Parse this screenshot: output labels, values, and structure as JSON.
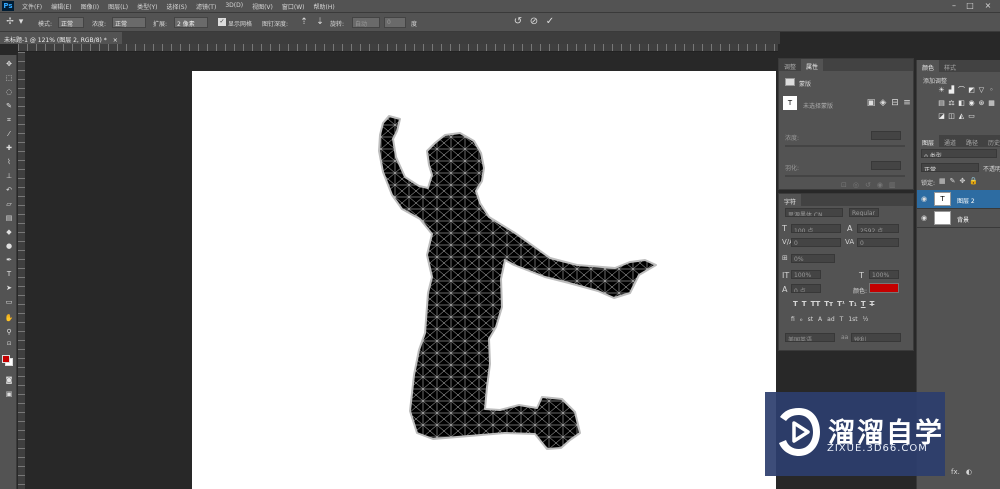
{
  "menubar": {
    "app_logo": "Ps",
    "items": [
      "文件(F)",
      "编辑(E)",
      "图像(I)",
      "图层(L)",
      "类型(Y)",
      "选择(S)",
      "滤镜(T)",
      "3D(D)",
      "视图(V)",
      "窗口(W)",
      "帮助(H)"
    ]
  },
  "options": {
    "mode_label": "模式:",
    "mode_value": "正常",
    "density_label": "浓度:",
    "density_value": "正常",
    "expand_label": "扩展:",
    "expand_value": "2 像素",
    "show_mesh_label": "显示网格",
    "pin_depth_label": "图钉深度:",
    "rotate_label": "旋转:",
    "rotate_value": "自动",
    "angle_value": "0",
    "angle_unit": "度"
  },
  "document_tab": {
    "title": "未标题-1 @ 121% (图层 2, RGB/8) *",
    "close": "×"
  },
  "properties_panel": {
    "tabs": [
      "调整",
      "属性"
    ],
    "mask_label": "蒙版",
    "no_mask_label": "未选择蒙版",
    "density_label": "浓度:",
    "feather_label": "羽化:"
  },
  "character_panel": {
    "title": "字符",
    "font_family": "思源黑体 CN",
    "font_style": "Regular",
    "font_size": "100 点",
    "leading": "2592 点",
    "kerning": "0",
    "tracking": "0",
    "scale_extra": "0%",
    "vertical_scale": "100%",
    "horizontal_scale": "100%",
    "baseline_shift": "0 点",
    "color_label": "颜色:",
    "color": "#c40000",
    "style_buttons": [
      "T",
      "T",
      "TT",
      "Tт",
      "T¹",
      "T₁",
      "T",
      "T"
    ],
    "opentype_buttons": [
      "fi",
      "ℴ",
      "st",
      "A",
      "ad",
      "T",
      "1st",
      "½"
    ],
    "language": "美国英语",
    "antialias": "锐利"
  },
  "right_panel": {
    "top_tabs": [
      "颜色",
      "样式"
    ],
    "add_adjustment_label": "添加调整",
    "layer_tabs": [
      "图层",
      "通道",
      "路径",
      "历史记"
    ],
    "kind_filter": "ρ 类型",
    "blend_mode": "正常",
    "opacity_label": "不透明",
    "lock_label": "锁定:",
    "layers": [
      {
        "name": "图层 2",
        "selected": true
      },
      {
        "name": "背景",
        "selected": false
      }
    ],
    "bottom_icons": [
      "fx.",
      "◐"
    ]
  },
  "watermark": {
    "title": "溜溜自学",
    "url": "ZIXUE.3D66.COM"
  },
  "colors": {
    "foreground": "#c40000",
    "background": "#ffffff"
  }
}
